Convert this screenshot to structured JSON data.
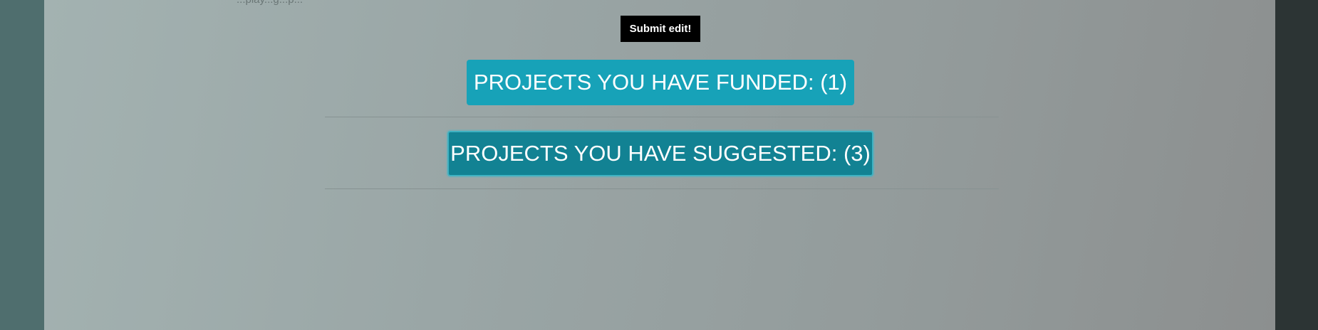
{
  "top_clipped_text": "...play...g...p...",
  "submit_button": {
    "label": "Submit edit!"
  },
  "projects": {
    "funded_label": "PROJECTS YOU HAVE FUNDED: (1)",
    "suggested_label": "PROJECTS YOU HAVE SUGGESTED: (3)"
  },
  "colors": {
    "funded_bg": "#17a2b8",
    "suggested_bg": "#128293",
    "submit_bg": "#000000"
  }
}
